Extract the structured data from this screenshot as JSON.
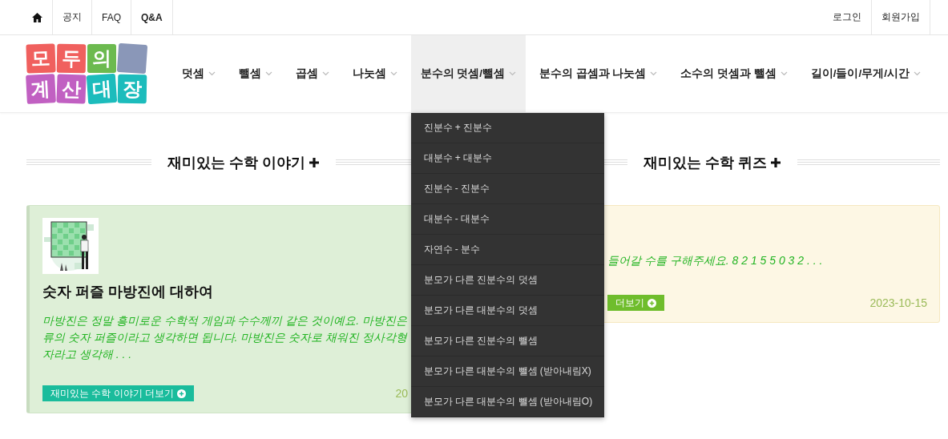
{
  "top_bar": {
    "left_links": [
      {
        "kind": "home"
      },
      {
        "kind": "text",
        "label": "공지"
      },
      {
        "kind": "text",
        "label": "FAQ"
      },
      {
        "kind": "text",
        "label": "Q&A"
      }
    ],
    "right_links": [
      "로그인",
      "회원가입"
    ]
  },
  "logo": {
    "tiles": [
      {
        "letter": "모",
        "color": "#f0605e"
      },
      {
        "letter": "두",
        "color": "#f0605e"
      },
      {
        "letter": "의",
        "color": "#6cba4f"
      },
      {
        "color": "#8a97b8"
      },
      {
        "letter": "계",
        "color": "#c160c2"
      },
      {
        "letter": "산",
        "color": "#c160c2"
      },
      {
        "letter": "대",
        "color": "#1cbcbc"
      },
      {
        "letter": "장",
        "color": "#1cbcbc"
      }
    ]
  },
  "nav": [
    {
      "label": "덧셈",
      "selected": false
    },
    {
      "label": "뺄셈",
      "selected": false
    },
    {
      "label": "곱셈",
      "selected": false
    },
    {
      "label": "나눗셈",
      "selected": false
    },
    {
      "label": "분수의 덧셈/뺄셈",
      "selected": true,
      "submenu": [
        "진분수 + 진분수",
        "대분수 + 대분수",
        "진분수 - 진분수",
        "대분수 - 대분수",
        "자연수 - 분수",
        "분모가 다른 진분수의 덧셈",
        "분모가 다른 대분수의 덧셈",
        "분모가 다른 진분수의 뺄셈",
        "분모가 다른 대분수의 뺄셈 (받아내림X)",
        "분모가 다른 대분수의 뺄셈 (받아내림O)"
      ]
    },
    {
      "label": "분수의 곱셈과 나눗셈",
      "selected": false
    },
    {
      "label": "소수의 덧셈과 뺄셈",
      "selected": false
    },
    {
      "label": "길이/들이/무게/시간",
      "selected": false
    }
  ],
  "sections": [
    {
      "heading": "재미있는 수학 이야기",
      "card": {
        "kind": "story",
        "picture": {
          "kind": "picture"
        },
        "title": "숫자 퍼즐 마방진에 대하여",
        "excerpt_lines": [
          "마방진은 정말 흥미로운 수학적 게임과 수수께끼 같은 것이예요. 마방진은",
          "류의 숫자 퍼즐이라고 생각하면 됩니다. 마방진은 숫자로 채워진 정사각형",
          "자라고 생각해 . . ."
        ],
        "button": "재미있는 수학 이야기 더보기",
        "date": "20"
      }
    },
    {
      "heading": "재미있는 수학 퀴즈",
      "card": {
        "kind": "quiz",
        "excerpt_lines": [
          "들어갈 수를 구해주세요. 8 2 1 5 5 0 3 2 . . ."
        ],
        "button": "더보기",
        "date": "2023-10-15"
      }
    }
  ]
}
